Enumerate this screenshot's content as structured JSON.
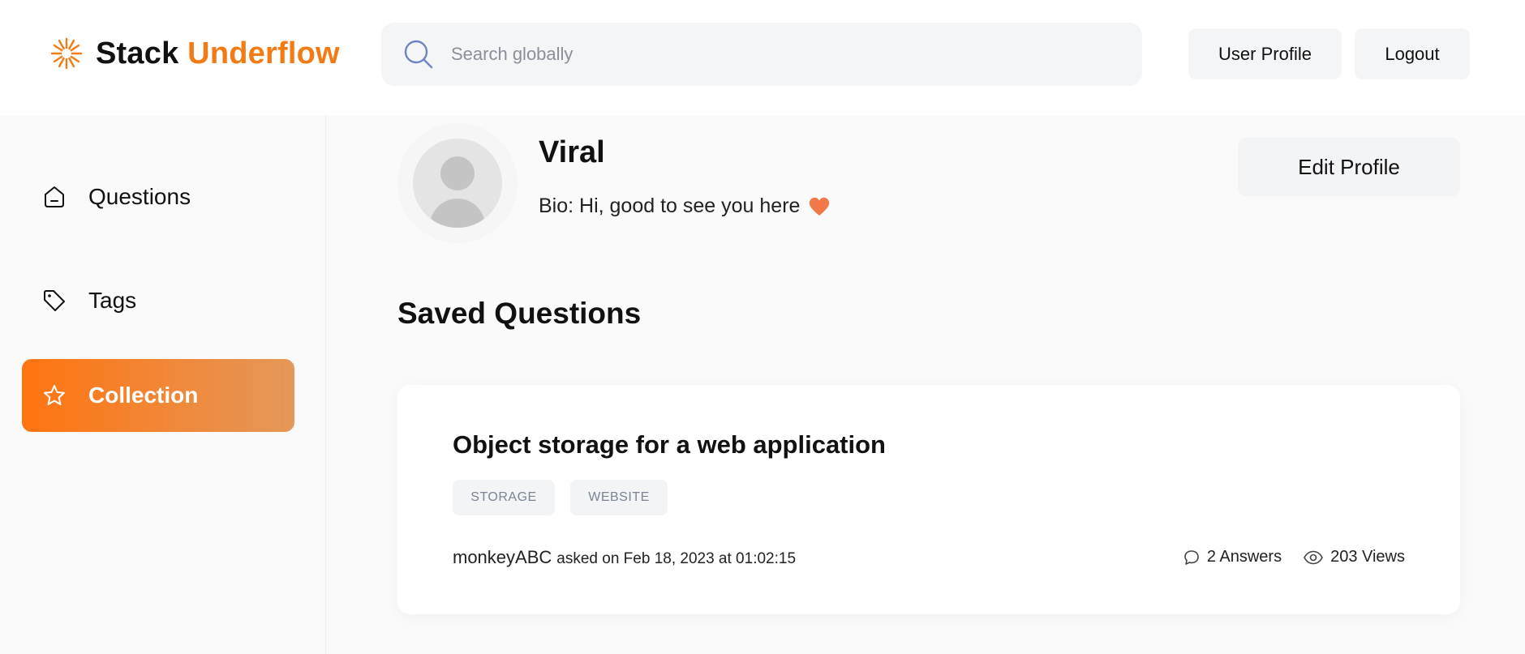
{
  "app": {
    "name_part1": "Stack",
    "name_part2": "Underflow",
    "accent_color": "#f27b16"
  },
  "header": {
    "search_placeholder": "Search globally",
    "user_profile_label": "User Profile",
    "logout_label": "Logout"
  },
  "sidebar": {
    "items": [
      {
        "label": "Questions",
        "icon": "home-icon",
        "active": false
      },
      {
        "label": "Tags",
        "icon": "tag-icon",
        "active": false
      },
      {
        "label": "Collection",
        "icon": "star-icon",
        "active": true
      }
    ]
  },
  "profile": {
    "name": "Viral",
    "bio": "Bio: Hi, good to see you here",
    "edit_label": "Edit Profile"
  },
  "saved": {
    "title": "Saved Questions",
    "questions": [
      {
        "title": "Object storage for a web application",
        "tags": [
          "STORAGE",
          "WEBSITE"
        ],
        "author": "monkeyABC",
        "asked": "asked on Feb 18, 2023 at 01:02:15",
        "answers": "2 Answers",
        "views": "203 Views"
      }
    ]
  }
}
